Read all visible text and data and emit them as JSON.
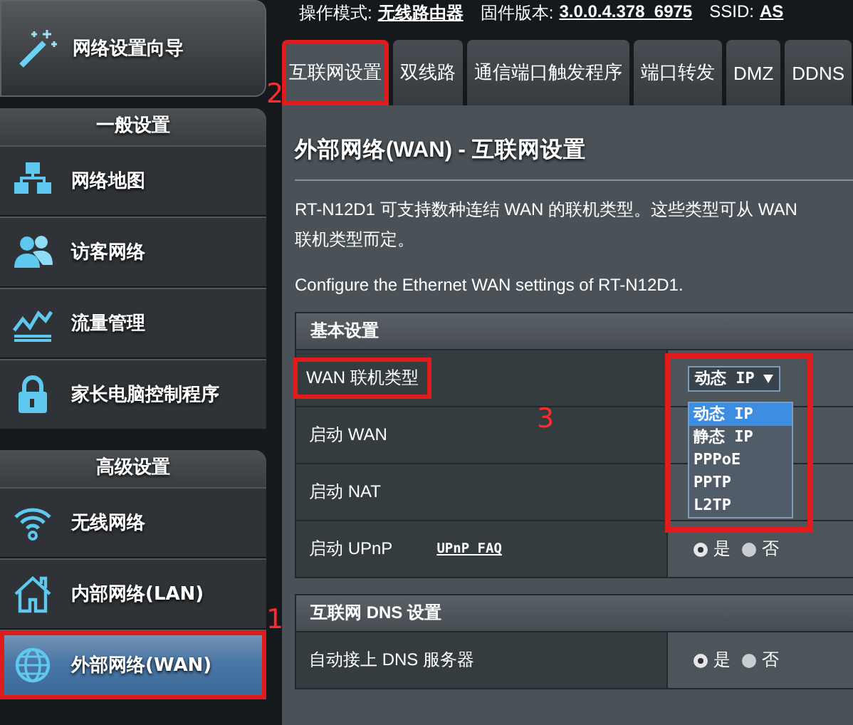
{
  "header": {
    "mode_label": "操作模式:",
    "mode_value": "无线路由器",
    "firmware_label": "固件版本:",
    "firmware_value": "3.0.0.4.378_6975",
    "ssid_label": "SSID:",
    "ssid_value": "AS"
  },
  "sidebar": {
    "wizard": {
      "label": "网络设置向导"
    },
    "sections": [
      {
        "title": "一般设置",
        "items": [
          {
            "label": "网络地图",
            "selected": false,
            "highlighted": false
          },
          {
            "label": "访客网络",
            "selected": false,
            "highlighted": false
          },
          {
            "label": "流量管理",
            "selected": false,
            "highlighted": false
          },
          {
            "label": "家长电脑控制程序",
            "selected": false,
            "highlighted": false
          }
        ]
      },
      {
        "title": "高级设置",
        "items": [
          {
            "label": "无线网络",
            "selected": false,
            "highlighted": false
          },
          {
            "label": "内部网络(LAN)",
            "selected": false,
            "highlighted": false
          },
          {
            "label": "外部网络(WAN)",
            "selected": true,
            "highlighted": true
          }
        ]
      }
    ]
  },
  "tabs": [
    {
      "label": "互联网设置",
      "selected": true,
      "highlighted": true
    },
    {
      "label": "双线路",
      "selected": false,
      "highlighted": false
    },
    {
      "label": "通信端口触发程序",
      "selected": false,
      "highlighted": false
    },
    {
      "label": "端口转发",
      "selected": false,
      "highlighted": false
    },
    {
      "label": "DMZ",
      "selected": false,
      "highlighted": false
    },
    {
      "label": "DDNS",
      "selected": false,
      "highlighted": false
    }
  ],
  "panel": {
    "title": "外部网络(WAN) - 互联网设置",
    "description": [
      "RT-N12D1 可支持数种连结 WAN 的联机类型。这些类型可从 WAN",
      "联机类型而定。"
    ],
    "note": "Configure the Ethernet WAN settings of RT-N12D1.",
    "sections": [
      {
        "title": "基本设置",
        "rows": [
          {
            "kind": "dropdown",
            "label": "WAN 联机类型",
            "label_highlighted": true,
            "value_highlighted": true,
            "value": "动态 IP",
            "open": true,
            "options": [
              {
                "label": "动态 IP",
                "selected": true
              },
              {
                "label": "静态 IP",
                "selected": false
              },
              {
                "label": "PPPoE",
                "selected": false
              },
              {
                "label": "PPTP",
                "selected": false
              },
              {
                "label": "L2TP",
                "selected": false
              }
            ]
          },
          {
            "kind": "plain",
            "label": "启动 WAN",
            "label_highlighted": false
          },
          {
            "kind": "plain",
            "label": "启动 NAT",
            "label_highlighted": false
          },
          {
            "kind": "radio",
            "label": "启动 UPnP",
            "link": "UPnP FAQ",
            "label_highlighted": false,
            "options": [
              {
                "label": "是",
                "selected": true
              },
              {
                "label": "否",
                "selected": false
              }
            ]
          }
        ]
      },
      {
        "title": "互联网 DNS 设置",
        "rows": [
          {
            "kind": "radio",
            "label": "自动接上 DNS 服务器",
            "label_highlighted": false,
            "options": [
              {
                "label": "是",
                "selected": true
              },
              {
                "label": "否",
                "selected": false
              }
            ]
          }
        ]
      }
    ]
  },
  "annotations": [
    {
      "label": "1"
    },
    {
      "label": "2"
    },
    {
      "label": "3"
    }
  ]
}
